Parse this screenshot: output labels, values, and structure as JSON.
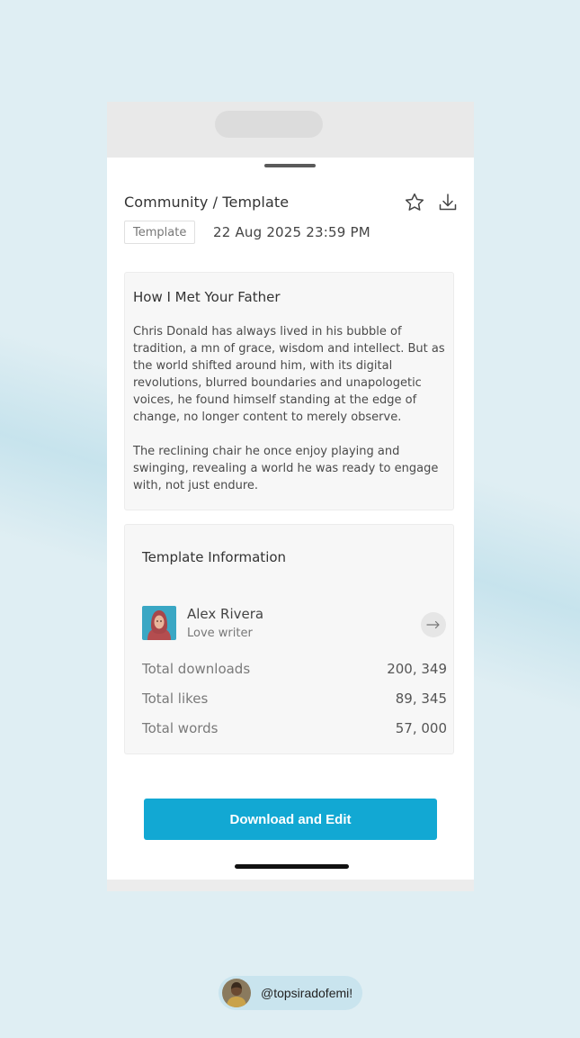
{
  "header": {
    "breadcrumb": "Community / Template",
    "tag": "Template",
    "date": "22 Aug 2025 23:59  PM"
  },
  "story": {
    "title": "How I Met Your Father",
    "paragraphs": [
      "Chris Donald has always lived in his bubble of tradition, a mn of grace, wisdom and intellect. But as the world shifted around him, with its digital revolutions, blurred boundaries and unapologetic voices, he found himself standing at the edge of change, no longer content to merely observe.",
      "The reclining chair he once  enjoy playing and swinging, revealing a world he was ready to engage with, not just endure."
    ]
  },
  "info": {
    "title": "Template Information",
    "author": {
      "name": "Alex Rivera",
      "role": "Love writer"
    },
    "stats": [
      {
        "label": "Total downloads",
        "value": "200, 349"
      },
      {
        "label": "Total likes",
        "value": "89, 345"
      },
      {
        "label": "Total words",
        "value": "57, 000"
      }
    ]
  },
  "cta_label": "Download and Edit",
  "credit_handle": "@topsiradofemi!",
  "icons": {
    "favorite": "star-icon",
    "download": "download-icon",
    "navigate": "arrow-right-icon"
  },
  "colors": {
    "accent": "#12a8d3",
    "background": "#dfeef3"
  }
}
